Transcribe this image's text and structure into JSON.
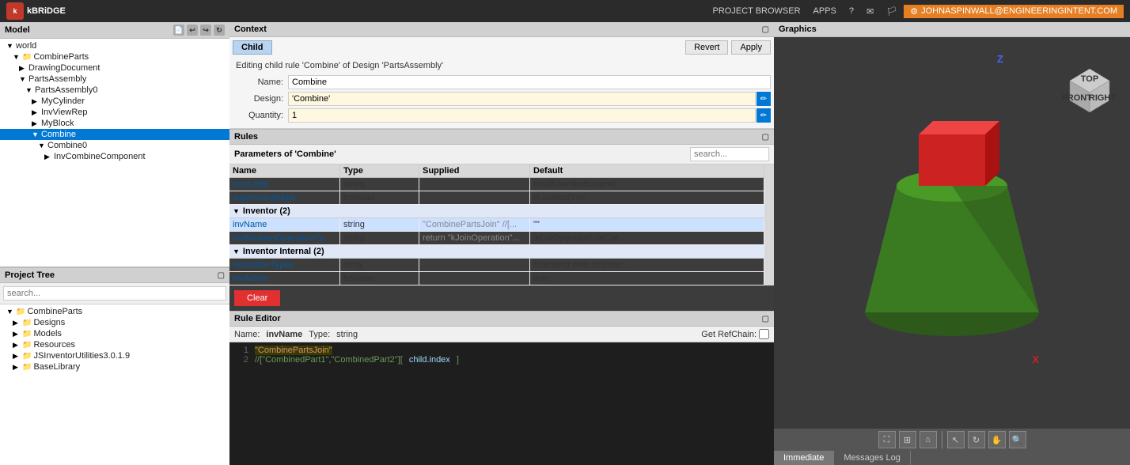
{
  "topbar": {
    "logo_text": "kBRiDGE",
    "nav_items": [
      "PROJECT BROWSER",
      "APPS",
      "?",
      "✉"
    ],
    "user": "JOHNASPINWALL@ENGINEERINGINTENT.COM"
  },
  "model_panel": {
    "title": "Model",
    "tree": [
      {
        "id": "world",
        "label": "world",
        "indent": 0,
        "expanded": true,
        "type": "root"
      },
      {
        "id": "combineParts",
        "label": "CombineParts",
        "indent": 1,
        "expanded": true,
        "type": "folder"
      },
      {
        "id": "drawingDocument",
        "label": "DrawingDocument",
        "indent": 2,
        "expanded": false,
        "type": "item"
      },
      {
        "id": "partsAssembly",
        "label": "PartsAssembly",
        "indent": 2,
        "expanded": true,
        "type": "item"
      },
      {
        "id": "partsAssembly0",
        "label": "PartsAssembly0",
        "indent": 3,
        "expanded": true,
        "type": "item"
      },
      {
        "id": "myCylinder",
        "label": "MyCylinder",
        "indent": 4,
        "expanded": false,
        "type": "item"
      },
      {
        "id": "invViewRep",
        "label": "InvViewRep",
        "indent": 4,
        "expanded": false,
        "type": "item"
      },
      {
        "id": "myBlock",
        "label": "MyBlock",
        "indent": 4,
        "expanded": false,
        "type": "item"
      },
      {
        "id": "combine",
        "label": "Combine",
        "indent": 4,
        "expanded": true,
        "type": "item",
        "selected": true
      },
      {
        "id": "combine0",
        "label": "Combine0",
        "indent": 5,
        "expanded": true,
        "type": "item"
      },
      {
        "id": "invCombineComponent",
        "label": "InvCombineComponent",
        "indent": 6,
        "expanded": false,
        "type": "item"
      }
    ]
  },
  "project_tree_panel": {
    "title": "Project Tree",
    "search_placeholder": "search...",
    "tree": [
      {
        "id": "combineParts",
        "label": "CombineParts",
        "indent": 0,
        "expanded": true,
        "type": "root"
      },
      {
        "id": "designs",
        "label": "Designs",
        "indent": 1,
        "expanded": false,
        "type": "folder"
      },
      {
        "id": "models",
        "label": "Models",
        "indent": 1,
        "expanded": false,
        "type": "folder"
      },
      {
        "id": "resources",
        "label": "Resources",
        "indent": 1,
        "expanded": false,
        "type": "folder"
      },
      {
        "id": "jsinventor",
        "label": "JSInventorUtilities3.0.1.9",
        "indent": 1,
        "expanded": false,
        "type": "folder"
      },
      {
        "id": "baseLibrary",
        "label": "BaseLibrary",
        "indent": 1,
        "expanded": false,
        "type": "folder"
      }
    ]
  },
  "context_panel": {
    "title": "Context",
    "child_tab": "Child",
    "editing_text": "Editing child rule 'Combine' of Design 'PartsAssembly'",
    "revert_label": "Revert",
    "apply_label": "Apply",
    "name_label": "Name:",
    "name_value": "Combine",
    "design_label": "Design:",
    "design_value": "'Combine'",
    "quantity_label": "Quantity:",
    "quantity_value": "1"
  },
  "rules_panel": {
    "title": "Rules",
    "params_label": "Parameters of 'Combine'",
    "search_placeholder": "search...",
    "columns": [
      "Name",
      "Type",
      "Supplied",
      "Default"
    ],
    "rows": [
      {
        "name": "treeLabel",
        "type": "string",
        "supplied": "",
        "default": "this[R.symbols.name]",
        "group": null
      },
      {
        "name": "suppressUpdate",
        "type": "boolean",
        "supplied": "",
        "default": "R.asleep(this)",
        "group": null
      },
      {
        "group": "Inventor (2)"
      },
      {
        "name": "invName",
        "type": "string",
        "supplied": "\"CombinePartsJoin\" //[\"...",
        "default": "\"\"",
        "group": null,
        "selected": true
      },
      {
        "name": "invBooleanOperationTy...",
        "type": "string",
        "supplied": "return \"kJoinOperation\"...",
        "default": "'kCutOperation' //kCut...",
        "group": null
      },
      {
        "group": "Inventor Internal (2)"
      },
      {
        "name": "restrictInvTypes",
        "type": "array",
        "supplied": "",
        "default": "//Iterating over children...",
        "group": null
      },
      {
        "name": "invActive",
        "type": "boolean",
        "supplied": "",
        "default": "true",
        "group": null
      }
    ],
    "clear_label": "Clear"
  },
  "rule_editor": {
    "title": "Rule Editor",
    "name_label": "Name:",
    "name_value": "invName",
    "type_label": "Type:",
    "type_value": "string",
    "refchain_label": "Get RefChain:",
    "code_lines": [
      {
        "num": "1",
        "content": "\"CombinePartsJoin\"",
        "type": "string"
      },
      {
        "num": "2",
        "content": "//[\"CombinedPart1\",\"CombinedPart2\"][child.index]",
        "type": "comment"
      }
    ]
  },
  "graphics_panel": {
    "title": "Graphics",
    "axis_z": "Z",
    "axis_x": "X",
    "toolbar_buttons": [
      "⛶",
      "⊞",
      "⌂",
      "|",
      "↖",
      "☉",
      "⬇",
      "🔍"
    ]
  },
  "bottom_tabs": {
    "tabs": [
      "Immediate",
      "Messages Log"
    ],
    "active": "Immediate"
  }
}
